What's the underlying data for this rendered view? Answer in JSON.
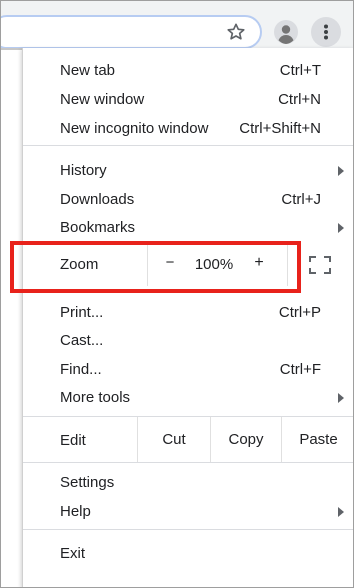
{
  "menu": {
    "sections": [
      [
        {
          "label": "New tab",
          "shortcut": "Ctrl+T"
        },
        {
          "label": "New window",
          "shortcut": "Ctrl+N"
        },
        {
          "label": "New incognito window",
          "shortcut": "Ctrl+Shift+N"
        }
      ],
      [
        {
          "label": "History",
          "submenu": true
        },
        {
          "label": "Downloads",
          "shortcut": "Ctrl+J"
        },
        {
          "label": "Bookmarks",
          "submenu": true
        }
      ],
      [
        {
          "label": "Print...",
          "shortcut": "Ctrl+P"
        },
        {
          "label": "Cast..."
        },
        {
          "label": "Find...",
          "shortcut": "Ctrl+F"
        },
        {
          "label": "More tools",
          "submenu": true
        }
      ],
      [
        {
          "label": "Settings"
        },
        {
          "label": "Help",
          "submenu": true
        }
      ],
      [
        {
          "label": "Exit"
        }
      ]
    ],
    "zoom": {
      "label": "Zoom",
      "minus": "−",
      "value": "100%",
      "plus": "+"
    },
    "edit": {
      "label": "Edit",
      "cut": "Cut",
      "copy": "Copy",
      "paste": "Paste"
    }
  },
  "colors": {
    "highlight": "#e8221b",
    "toolbar_bg": "#f1f3f4",
    "omnibox_border": "#b7ccf2"
  },
  "icons": [
    "star-icon",
    "avatar-icon",
    "kebab-menu-icon",
    "fullscreen-icon",
    "submenu-arrow-icon"
  ]
}
